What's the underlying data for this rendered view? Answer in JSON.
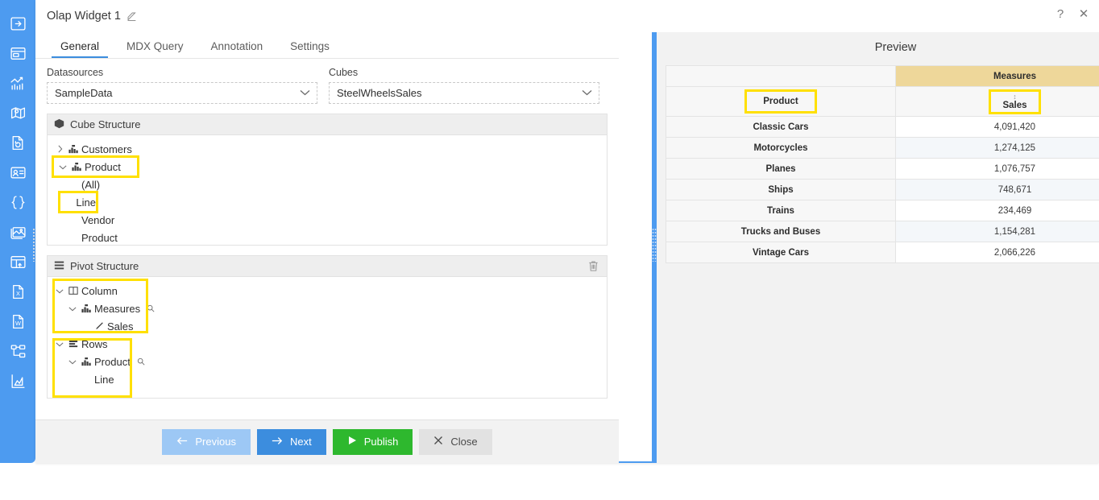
{
  "sidebar": {
    "items": [
      {
        "name": "arrow-right-box-icon",
        "label": "Navigate"
      },
      {
        "name": "dashboard-panel-icon",
        "label": "Dashboard"
      },
      {
        "name": "line-chart-icon",
        "label": "Chart"
      },
      {
        "name": "map-pin-icon",
        "label": "Map"
      },
      {
        "name": "document-refresh-icon",
        "label": "Document"
      },
      {
        "name": "id-card-icon",
        "label": "Card"
      },
      {
        "name": "code-braces-icon",
        "label": "Code"
      },
      {
        "name": "image-icon",
        "label": "Image"
      },
      {
        "name": "table-grid-icon",
        "label": "Table"
      },
      {
        "name": "excel-file-icon",
        "label": "Excel"
      },
      {
        "name": "word-file-icon",
        "label": "Word"
      },
      {
        "name": "tree-hierarchy-icon",
        "label": "Hierarchy"
      },
      {
        "name": "area-chart-icon",
        "label": "Analytics"
      }
    ]
  },
  "titlebar": {
    "title": "Olap Widget 1",
    "edit_icon": "pencil-square-icon",
    "help_label": "?",
    "close_label": "✕"
  },
  "tabs": [
    {
      "label": "General",
      "active": true
    },
    {
      "label": "MDX Query",
      "active": false
    },
    {
      "label": "Annotation",
      "active": false
    },
    {
      "label": "Settings",
      "active": false
    }
  ],
  "fields": {
    "datasources": {
      "label": "Datasources",
      "value": "SampleData",
      "chevron": "chevron-down-icon"
    },
    "cubes": {
      "label": "Cubes",
      "value": "SteelWheelsSales",
      "chevron": "chevron-down-icon"
    }
  },
  "cube_structure": {
    "title": "Cube Structure",
    "icon": "cube-icon",
    "nodes": [
      {
        "label": "Customers",
        "twisty": "›",
        "icon": "hierarchy-icon",
        "indent": 0,
        "highlight": false
      },
      {
        "label": "Product",
        "twisty": "⌄",
        "icon": "hierarchy-icon",
        "indent": 0,
        "highlight": true
      },
      {
        "label": "(All)",
        "twisty": "",
        "icon": "",
        "indent": 1,
        "highlight": false
      },
      {
        "label": "Line",
        "twisty": "",
        "icon": "",
        "indent": 1,
        "highlight": true
      },
      {
        "label": "Vendor",
        "twisty": "",
        "icon": "",
        "indent": 1,
        "highlight": false
      },
      {
        "label": "Product",
        "twisty": "",
        "icon": "",
        "indent": 1,
        "highlight": false
      }
    ]
  },
  "pivot_structure": {
    "title": "Pivot Structure",
    "icon": "list-icon",
    "trash_icon": "trash-icon",
    "nodes": [
      {
        "label": "Column",
        "twisty": "⌄",
        "icon": "column-icon",
        "indent": 0,
        "search": false
      },
      {
        "label": "Measures",
        "twisty": "⌄",
        "icon": "hierarchy-icon",
        "indent": 1,
        "search": true
      },
      {
        "label": "Sales",
        "twisty": "",
        "icon": "measure-icon",
        "indent": 2,
        "search": false
      },
      {
        "label": "Rows",
        "twisty": "⌄",
        "icon": "rows-icon",
        "indent": 0,
        "search": false
      },
      {
        "label": "Product",
        "twisty": "⌄",
        "icon": "hierarchy-icon",
        "indent": 1,
        "search": true
      },
      {
        "label": "Line",
        "twisty": "",
        "icon": "",
        "indent": 2,
        "search": false
      }
    ]
  },
  "footer": {
    "previous": {
      "label": "Previous",
      "icon": "arrow-left-icon"
    },
    "next": {
      "label": "Next",
      "icon": "arrow-right-icon"
    },
    "publish": {
      "label": "Publish",
      "icon": "play-icon"
    },
    "close": {
      "label": "Close",
      "icon": "x-icon"
    }
  },
  "preview": {
    "title": "Preview",
    "measures_header": "Measures",
    "product_header": "Product",
    "sales_header": "Sales",
    "sort_glyph": "↕"
  },
  "chart_data": {
    "type": "table",
    "title": "Preview",
    "columns": [
      "Product",
      "Sales"
    ],
    "categories": [
      "Classic Cars",
      "Motorcycles",
      "Planes",
      "Ships",
      "Trains",
      "Trucks and Buses",
      "Vintage Cars"
    ],
    "values": [
      4091420,
      1274125,
      1076757,
      748671,
      234469,
      1154281,
      2066226
    ],
    "rows": [
      {
        "product": "Classic Cars",
        "sales": "4,091,420"
      },
      {
        "product": "Motorcycles",
        "sales": "1,274,125"
      },
      {
        "product": "Planes",
        "sales": "1,076,757"
      },
      {
        "product": "Ships",
        "sales": "748,671"
      },
      {
        "product": "Trains",
        "sales": "234,469"
      },
      {
        "product": "Trucks and Buses",
        "sales": "1,154,281"
      },
      {
        "product": "Vintage Cars",
        "sales": "2,066,226"
      }
    ]
  },
  "colors": {
    "accent_blue": "#4d9bf0",
    "tab_underline": "#3c8dde",
    "publish_green": "#2eb82e",
    "measures_amber": "#eed79a",
    "highlight_yellow": "#ffe000"
  }
}
